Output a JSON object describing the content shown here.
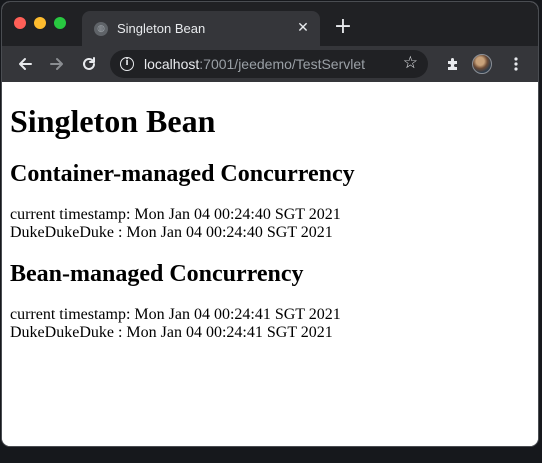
{
  "browser": {
    "tab": {
      "title": "Singleton Bean",
      "favicon": "globe-icon"
    },
    "new_tab_icon": "plus-icon",
    "address": {
      "host": "localhost",
      "rest": ":7001/jeedemo/TestServlet"
    },
    "colors": {
      "tabstrip": "#202124",
      "toolbar": "#35363a",
      "close": "#ff5f57",
      "minimize": "#febc2e",
      "maximize": "#28c840"
    }
  },
  "page": {
    "title": "Singleton Bean",
    "sections": [
      {
        "heading": "Container-managed Concurrency",
        "line1": "current timestamp: Mon Jan 04 00:24:40 SGT 2021",
        "line2": "DukeDukeDuke : Mon Jan 04 00:24:40 SGT 2021"
      },
      {
        "heading": "Bean-managed Concurrency",
        "line1": "current timestamp: Mon Jan 04 00:24:41 SGT 2021",
        "line2": "DukeDukeDuke : Mon Jan 04 00:24:41 SGT 2021"
      }
    ]
  }
}
